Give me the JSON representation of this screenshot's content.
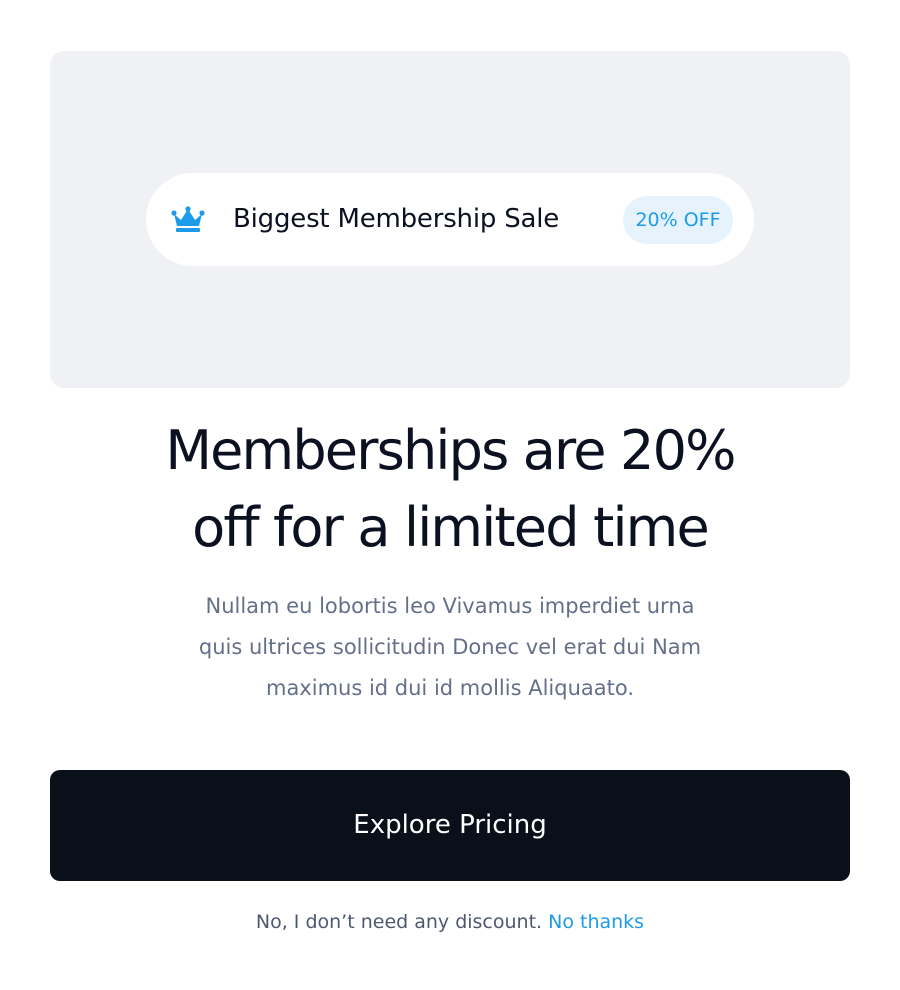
{
  "promo": {
    "pill_label": "Biggest Membership Sale",
    "badge": "20% OFF",
    "icon": "crown-icon"
  },
  "headline": {
    "line1": "Memberships are 20%",
    "line2": "off for a limited time"
  },
  "description": {
    "line1": "Nullam eu lobortis leo Vivamus imperdiet urna",
    "line2": "quis ultrices sollicitudin Donec vel erat dui Nam",
    "line3": "maximus id dui id mollis Aliquaato."
  },
  "cta": {
    "label": "Explore Pricing"
  },
  "decline": {
    "text": "No, I don’t need any discount.",
    "link": "No thanks"
  },
  "colors": {
    "accent": "#1e9be8",
    "button_bg": "#0a101a",
    "panel_bg": "#f0f1f4",
    "badge_bg": "#e6f3fd",
    "heading": "#0b1120",
    "body_text": "#64708a"
  }
}
